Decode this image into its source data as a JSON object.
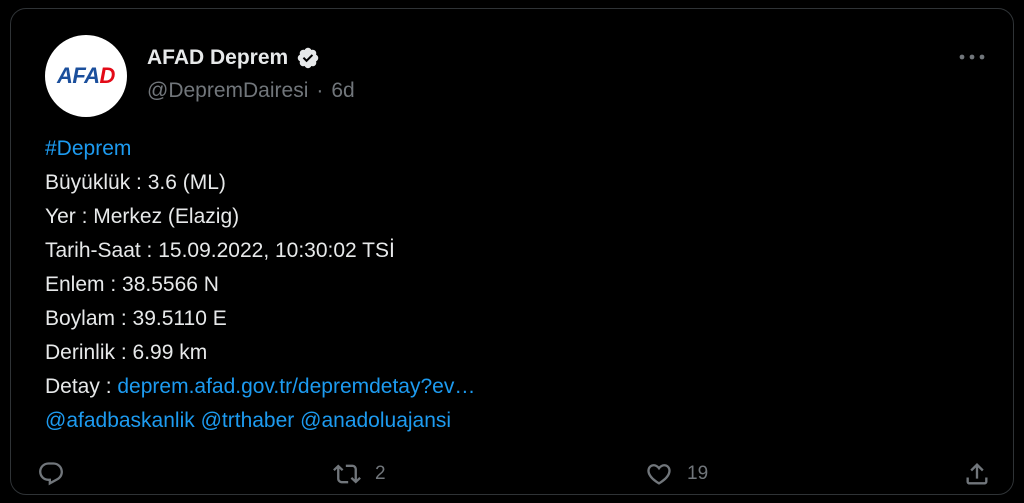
{
  "tweet": {
    "author": {
      "display_name": "AFAD Deprem",
      "handle": "@DepremDairesi",
      "separator": "·",
      "time": "6d",
      "avatar_text_main": "AFA",
      "avatar_text_accent": "D",
      "verified": true
    },
    "body": {
      "hashtag": "#Deprem",
      "magnitude": "Büyüklük : 3.6 (ML)",
      "location": "Yer : Merkez (Elazig)",
      "datetime": "Tarih-Saat : 15.09.2022, 10:30:02 TSİ",
      "latitude": "Enlem : 38.5566 N",
      "longitude": "Boylam : 39.5110 E",
      "depth": "Derinlik : 6.99 km",
      "detail_label": "Detay : ",
      "detail_link": "deprem.afad.gov.tr/depremdetay?ev…",
      "mention_1": "@afadbaskanlik",
      "mention_2": "@trthaber",
      "mention_3": "@anadoluajansi"
    },
    "actions": {
      "reply_icon": "reply-icon",
      "retweet_icon": "retweet-icon",
      "retweet_count": "2",
      "like_icon": "heart-icon",
      "like_count": "19",
      "share_icon": "share-icon",
      "more_icon": "more-dots-icon"
    }
  },
  "colors": {
    "background": "#000000",
    "text": "#e7e9ea",
    "secondary": "#71767b",
    "link": "#1d9bf0",
    "border": "#2f3336",
    "avatar_blue": "#1b4f9c",
    "avatar_red": "#e30a17"
  }
}
